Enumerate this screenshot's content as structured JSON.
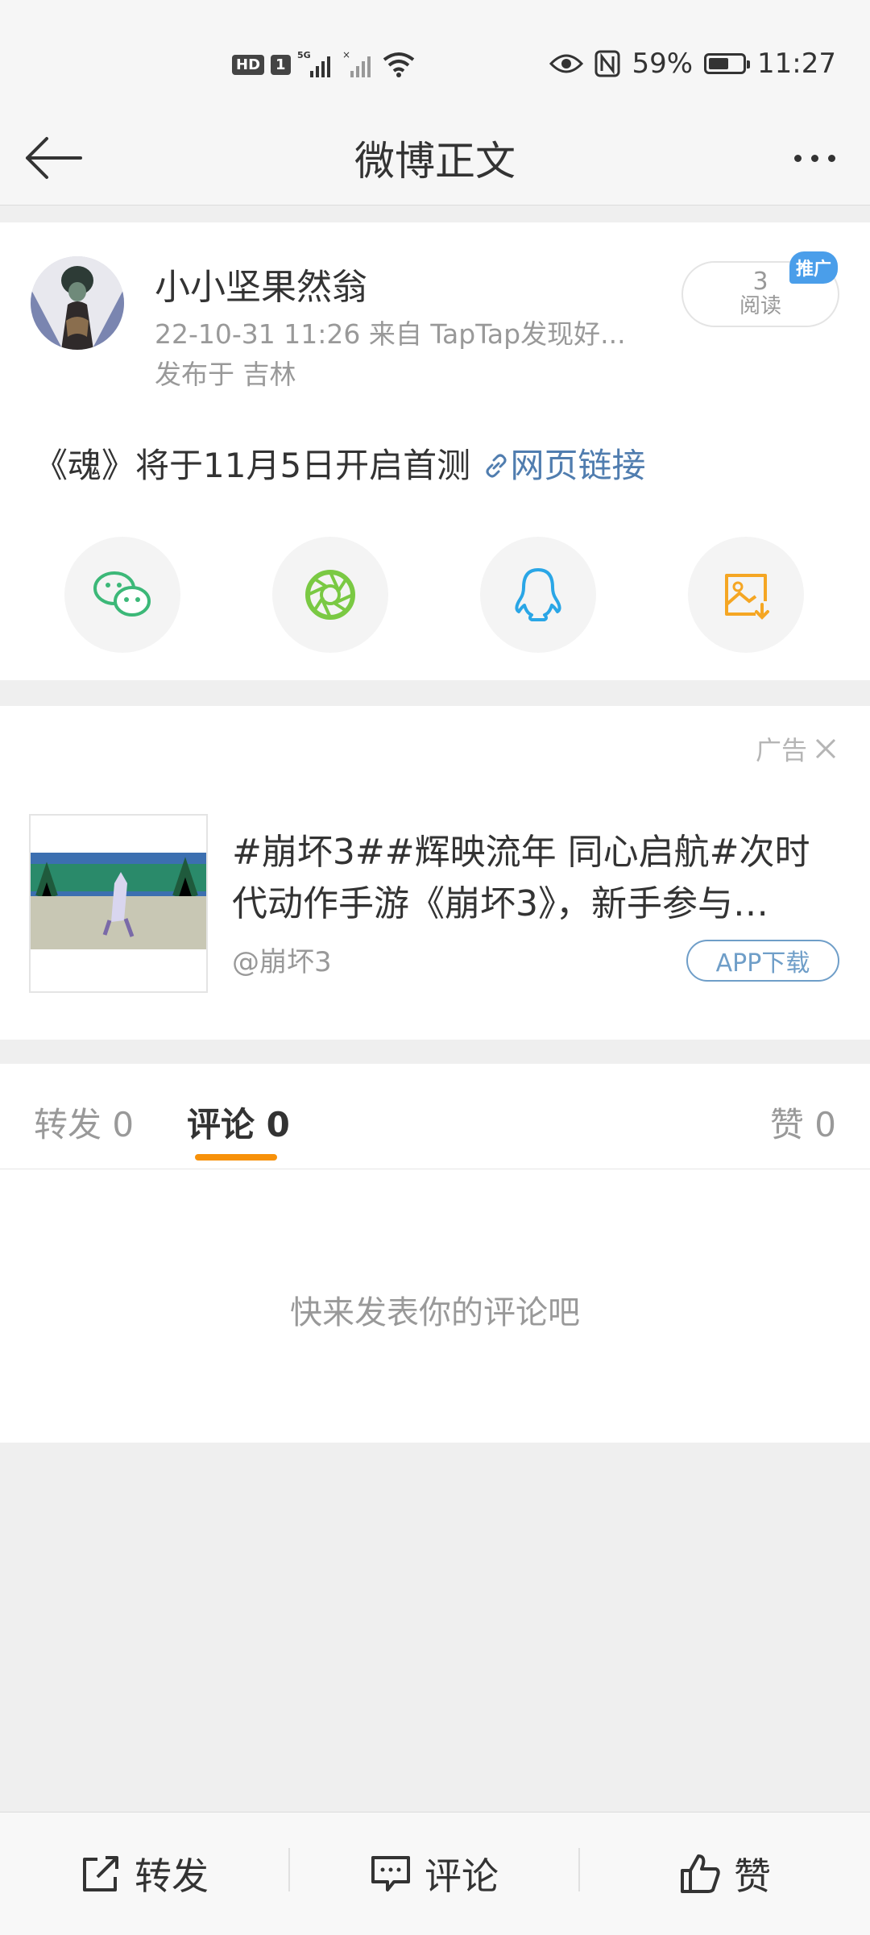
{
  "status_bar": {
    "hd_label": "HD",
    "sim_label": "1",
    "network_label": "5G",
    "battery_percent": "59%",
    "battery_level": 0.59,
    "time": "11:27"
  },
  "header": {
    "title": "微博正文",
    "back_icon": "arrow-left-icon",
    "more_icon": "more-dots-icon"
  },
  "post": {
    "author": "小小坚果然翁",
    "meta": "22-10-31 11:26  来自 TapTap发现好...",
    "location": "发布于 吉林",
    "read_count": "3",
    "read_label": "阅读",
    "promo_badge": "推广",
    "text": "《魂》将于11月5日开启首测 ",
    "link_text": "网页链接",
    "share_icons": [
      "wechat-icon",
      "moments-icon",
      "qq-icon",
      "save-image-icon"
    ]
  },
  "ad": {
    "label": "广告",
    "title_line1": "#崩坏3##辉映流年 同心启航#次时",
    "title_line2": "代动作手游《崩坏3》，新手参与…",
    "source": "@崩坏3",
    "download_label": "APP下载"
  },
  "tabs": {
    "repost": "转发 0",
    "comment": "评论 0",
    "like": "赞 0",
    "active": "comment",
    "empty_text": "快来发表你的评论吧"
  },
  "bottom_bar": {
    "repost_label": "转发",
    "comment_label": "评论",
    "like_label": "赞"
  },
  "colors": {
    "accent": "#f7910a",
    "link": "#507daf",
    "wechat": "#3cb878",
    "moments": "#7ac943",
    "qq": "#2aa6e6",
    "save": "#f5a623"
  }
}
